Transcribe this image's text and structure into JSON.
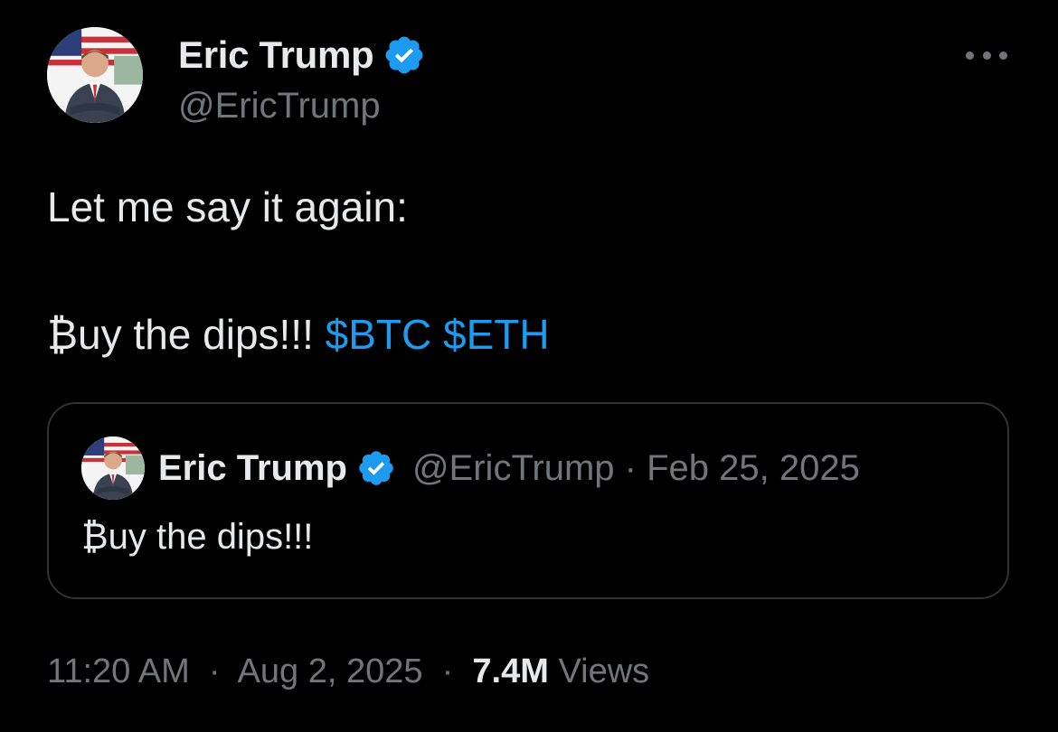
{
  "author": {
    "display_name": "Eric Trump",
    "handle": "@EricTrump",
    "verified": true,
    "verified_color": "#1d9bf0"
  },
  "tweet": {
    "line1": "Let me say it again:",
    "line2_text": "₿uy the dips!!!",
    "cashtags": [
      "$BTC",
      "$ETH"
    ]
  },
  "quoted": {
    "display_name": "Eric Trump",
    "handle": "@EricTrump",
    "separator": "·",
    "date": "Feb 25, 2025",
    "text": "₿uy the dips!!!"
  },
  "footer": {
    "time": "11:20 AM",
    "separator": "·",
    "date": "Aug 2, 2025",
    "views_count": "7.4M",
    "views_label": "Views"
  },
  "icons": {
    "more": "more-horizontal-icon",
    "verified": "verified-badge-icon"
  },
  "colors": {
    "background": "#000000",
    "text": "#e7e9ea",
    "secondary": "#71767b",
    "accent": "#1d9bf0",
    "border": "#2f3336"
  }
}
